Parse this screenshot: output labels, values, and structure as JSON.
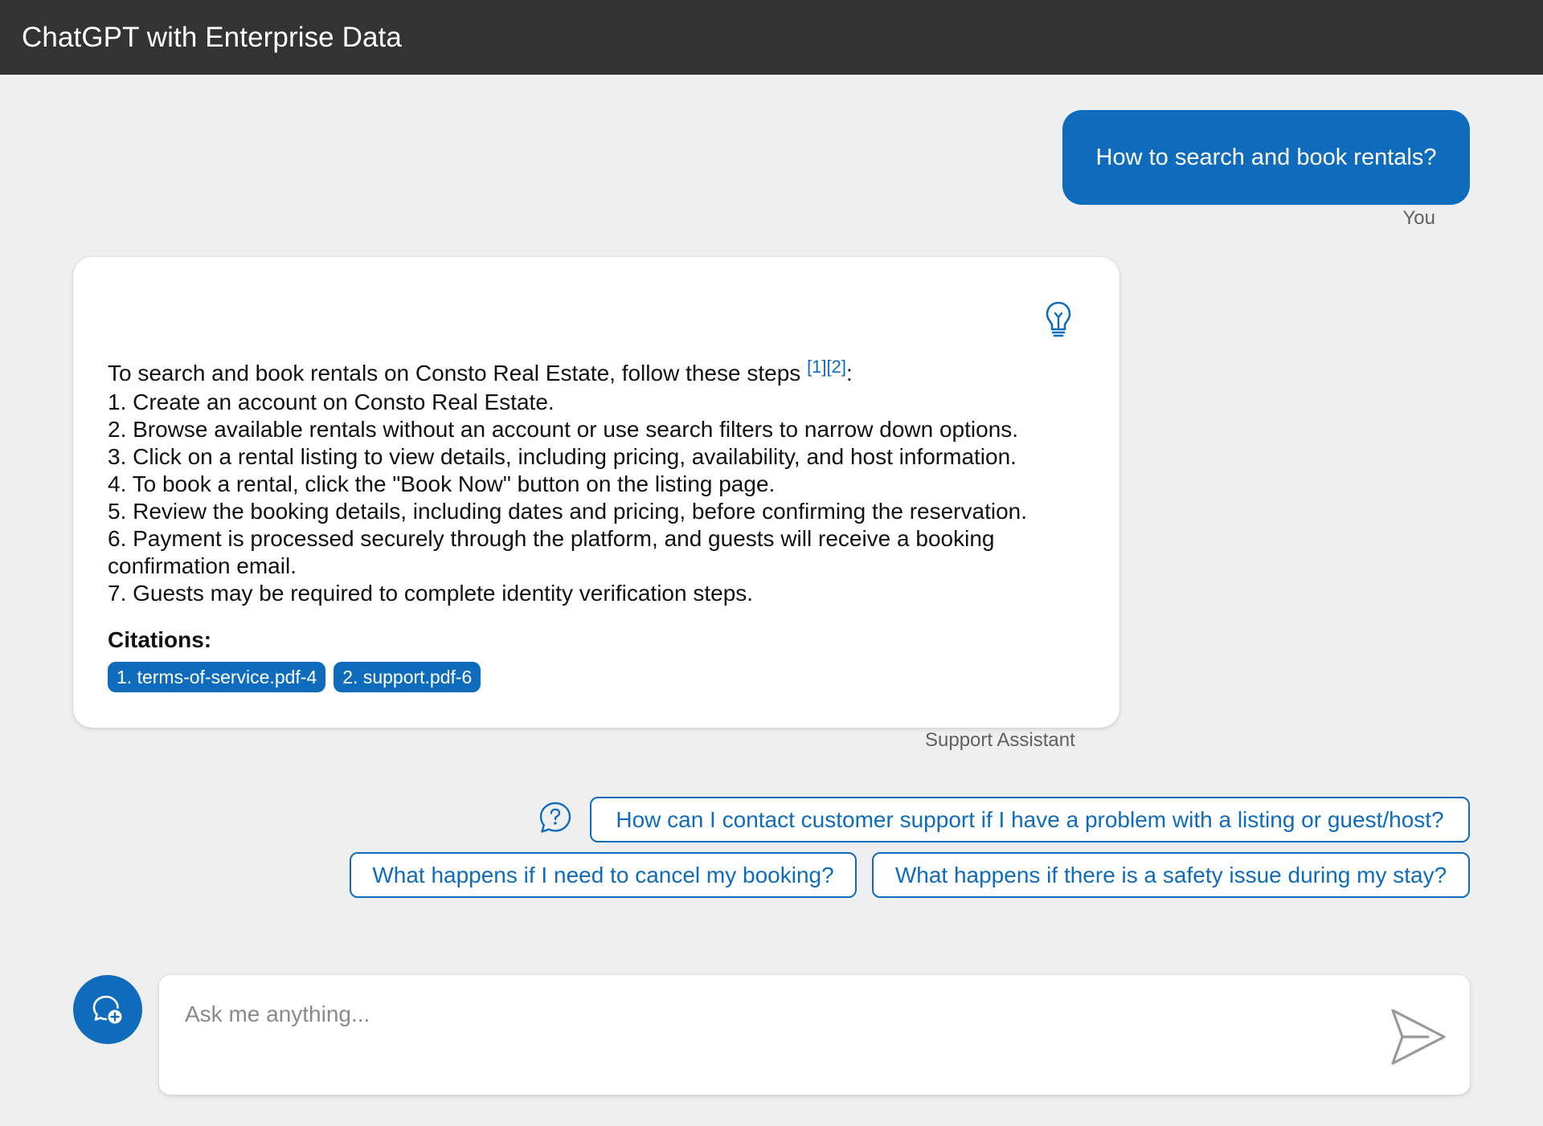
{
  "header": {
    "title": "ChatGPT with Enterprise Data"
  },
  "user_message": {
    "text": "How to search and book rentals?",
    "author": "You"
  },
  "assistant_message": {
    "intro": "To search and book rentals on Consto Real Estate, follow these steps ",
    "intro_citations": "[1][2]",
    "intro_end": ":",
    "steps": [
      "1. Create an account on Consto Real Estate.",
      "2. Browse available rentals without an account or use search filters to narrow down options.",
      "3. Click on a rental listing to view details, including pricing, availability, and host information.",
      "4. To book a rental, click the \"Book Now\" button on the listing page.",
      "5. Review the booking details, including dates and pricing, before confirming the reservation.",
      "6. Payment is processed securely through the platform, and guests will receive a booking confirmation email.",
      "7. Guests may be required to complete identity verification steps."
    ],
    "citations_title": "Citations:",
    "citations": [
      "1. terms-of-service.pdf-4",
      "2. support.pdf-6"
    ],
    "author": "Support Assistant",
    "thought_icon": "lightbulb-icon"
  },
  "followups": [
    "How can I contact customer support if I have a problem with a listing or guest/host?",
    "What happens if I need to cancel my booking?",
    "What happens if there is a safety issue during my stay?"
  ],
  "input": {
    "placeholder": "Ask me anything...",
    "value": ""
  },
  "icons": {
    "new_chat": "new-chat-icon",
    "followup": "question-icon",
    "send": "send-icon"
  },
  "colors": {
    "accent": "#0f6cbd",
    "header_bg": "#333333",
    "page_bg": "#efefef"
  }
}
